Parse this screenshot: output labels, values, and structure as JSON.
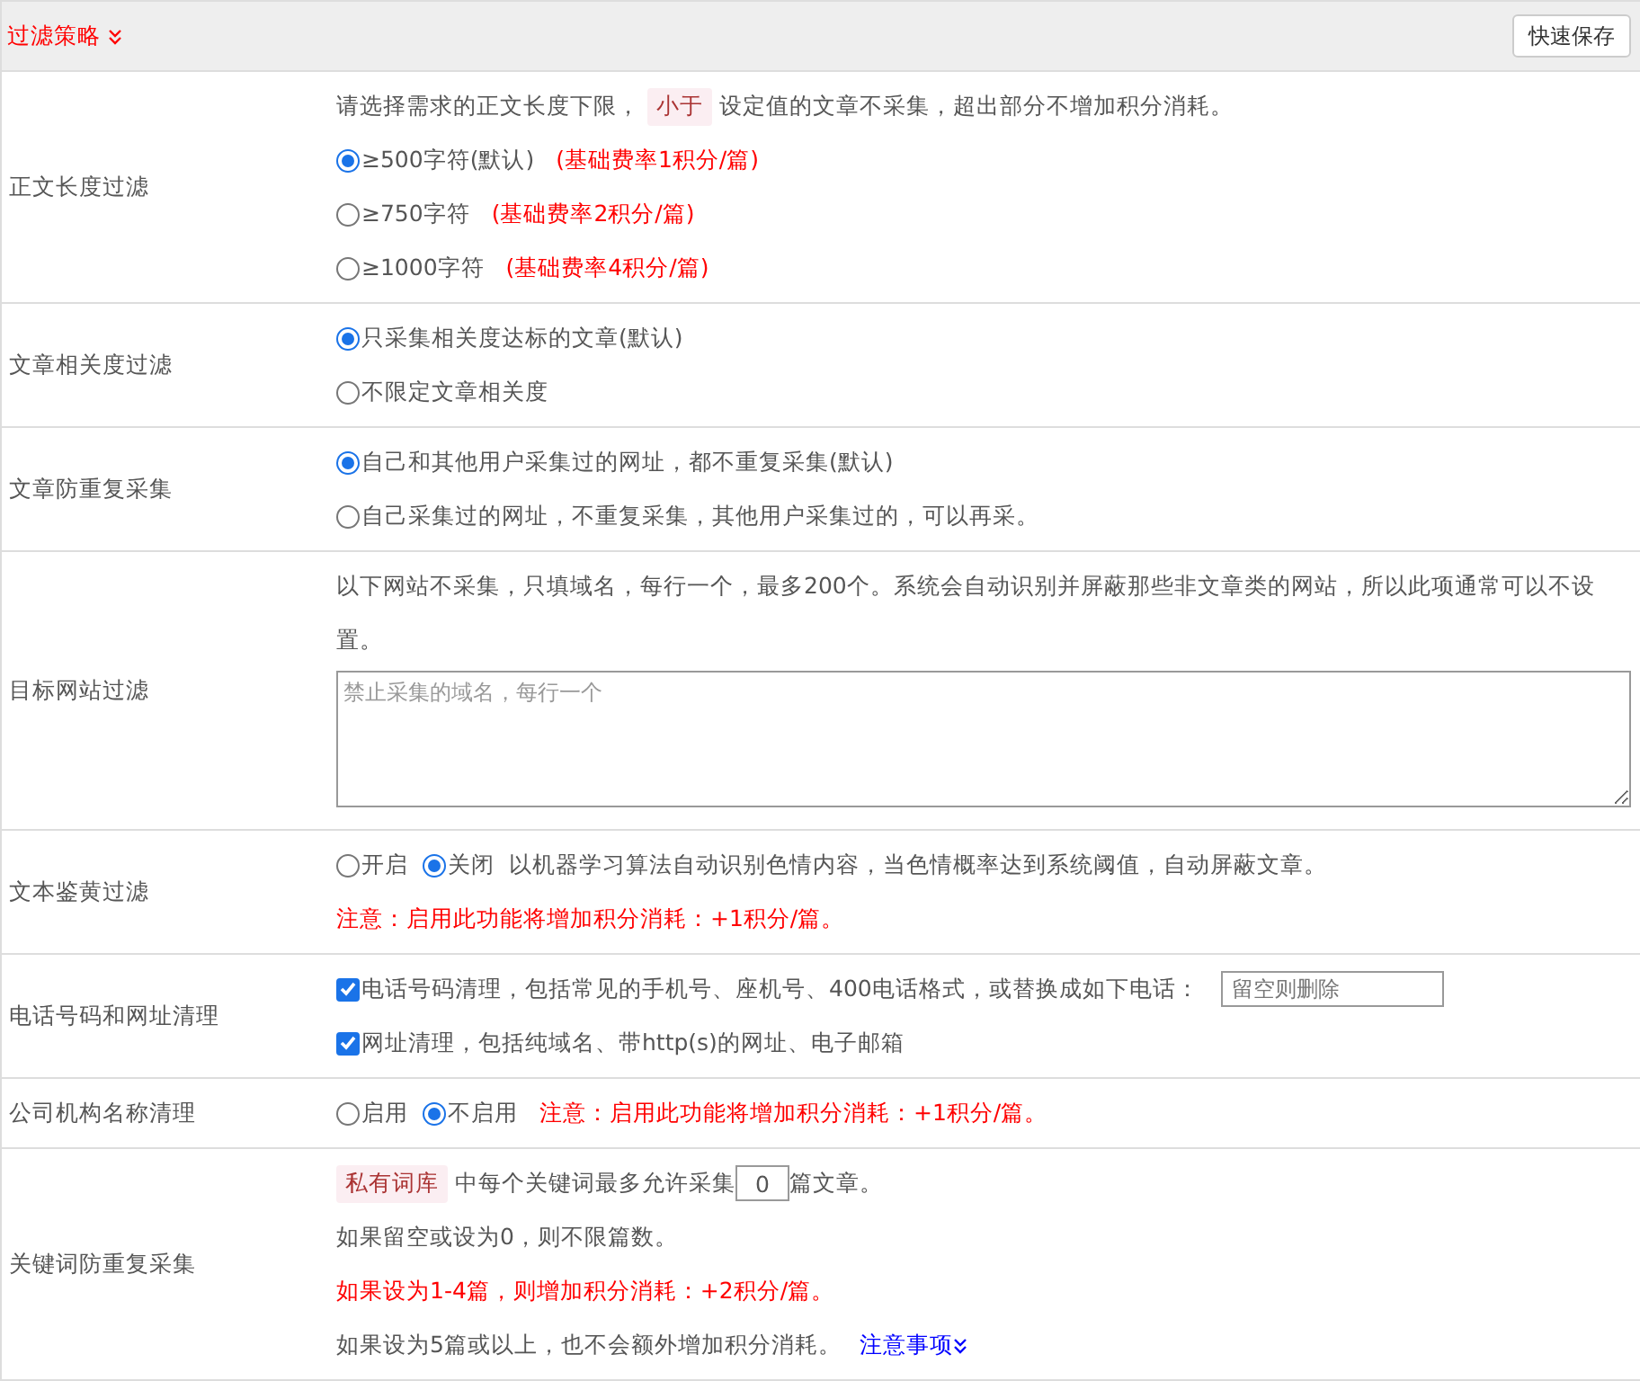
{
  "header": {
    "title": "过滤策略",
    "save_button": "快速保存"
  },
  "rows": [
    {
      "kind": "radio",
      "label": "正文长度过滤",
      "intro": {
        "before": "请选择需求的正文长度下限，",
        "tag": "小于",
        "after": "设定值的文章不采集，超出部分不增加积分消耗。"
      },
      "options": [
        {
          "text": "≥500字符(默认)",
          "note": "(基础费率1积分/篇)",
          "selected": true
        },
        {
          "text": "≥750字符",
          "note": "(基础费率2积分/篇)",
          "selected": false
        },
        {
          "text": "≥1000字符",
          "note": "(基础费率4积分/篇)",
          "selected": false
        }
      ]
    },
    {
      "kind": "radio",
      "label": "文章相关度过滤",
      "options": [
        {
          "text": "只采集相关度达标的文章(默认)",
          "selected": true
        },
        {
          "text": "不限定文章相关度",
          "selected": false
        }
      ]
    },
    {
      "kind": "radio",
      "label": "文章防重复采集",
      "options": [
        {
          "text": "自己和其他用户采集过的网址，都不重复采集(默认)",
          "selected": true
        },
        {
          "text": "自己采集过的网址，不重复采集，其他用户采集过的，可以再采。",
          "selected": false
        }
      ]
    },
    {
      "kind": "textarea",
      "label": "目标网站过滤",
      "description": "以下网站不采集，只填域名，每行一个，最多200个。系统会自动识别并屏蔽那些非文章类的网站，所以此项通常可以不设置。",
      "placeholder": "禁止采集的域名，每行一个"
    },
    {
      "kind": "inline_radio",
      "label": "文本鉴黄过滤",
      "options": [
        {
          "text": "开启",
          "selected": false
        },
        {
          "text": "关闭",
          "selected": true
        }
      ],
      "description": "以机器学习算法自动识别色情内容，当色情概率达到系统阈值，自动屏蔽文章。",
      "lines": [
        {
          "text": "注意：启用此功能将增加积分消耗：+1积分/篇。",
          "warning": true
        }
      ]
    },
    {
      "kind": "checkbox",
      "label": "电话号码和网址清理",
      "items": [
        {
          "text": "电话号码清理，包括常见的手机号、座机号、400电话格式，或替换成如下电话：",
          "checked": true,
          "placeholder": "留空则删除"
        },
        {
          "text": "网址清理，包括纯域名、带http(s)的网址、电子邮箱",
          "checked": true
        }
      ]
    },
    {
      "kind": "inline_radio",
      "label": "公司机构名称清理",
      "options": [
        {
          "text": "启用",
          "selected": false
        },
        {
          "text": "不启用",
          "selected": true
        }
      ],
      "note": "注意：启用此功能将增加积分消耗：+1积分/篇。"
    },
    {
      "kind": "keyword",
      "label": "关键词防重复采集",
      "tag": "私有词库",
      "before": "中每个关键词最多允许采集",
      "value": "0",
      "after": "篇文章。",
      "lines": [
        {
          "text": "如果留空或设为0，则不限篇数。",
          "warning": false
        },
        {
          "text": "如果设为1-4篇，则增加积分消耗：+2积分/篇。",
          "warning": true
        },
        {
          "text": "如果设为5篇或以上，也不会额外增加积分消耗。",
          "warning": false,
          "link": "注意事项"
        }
      ]
    }
  ]
}
